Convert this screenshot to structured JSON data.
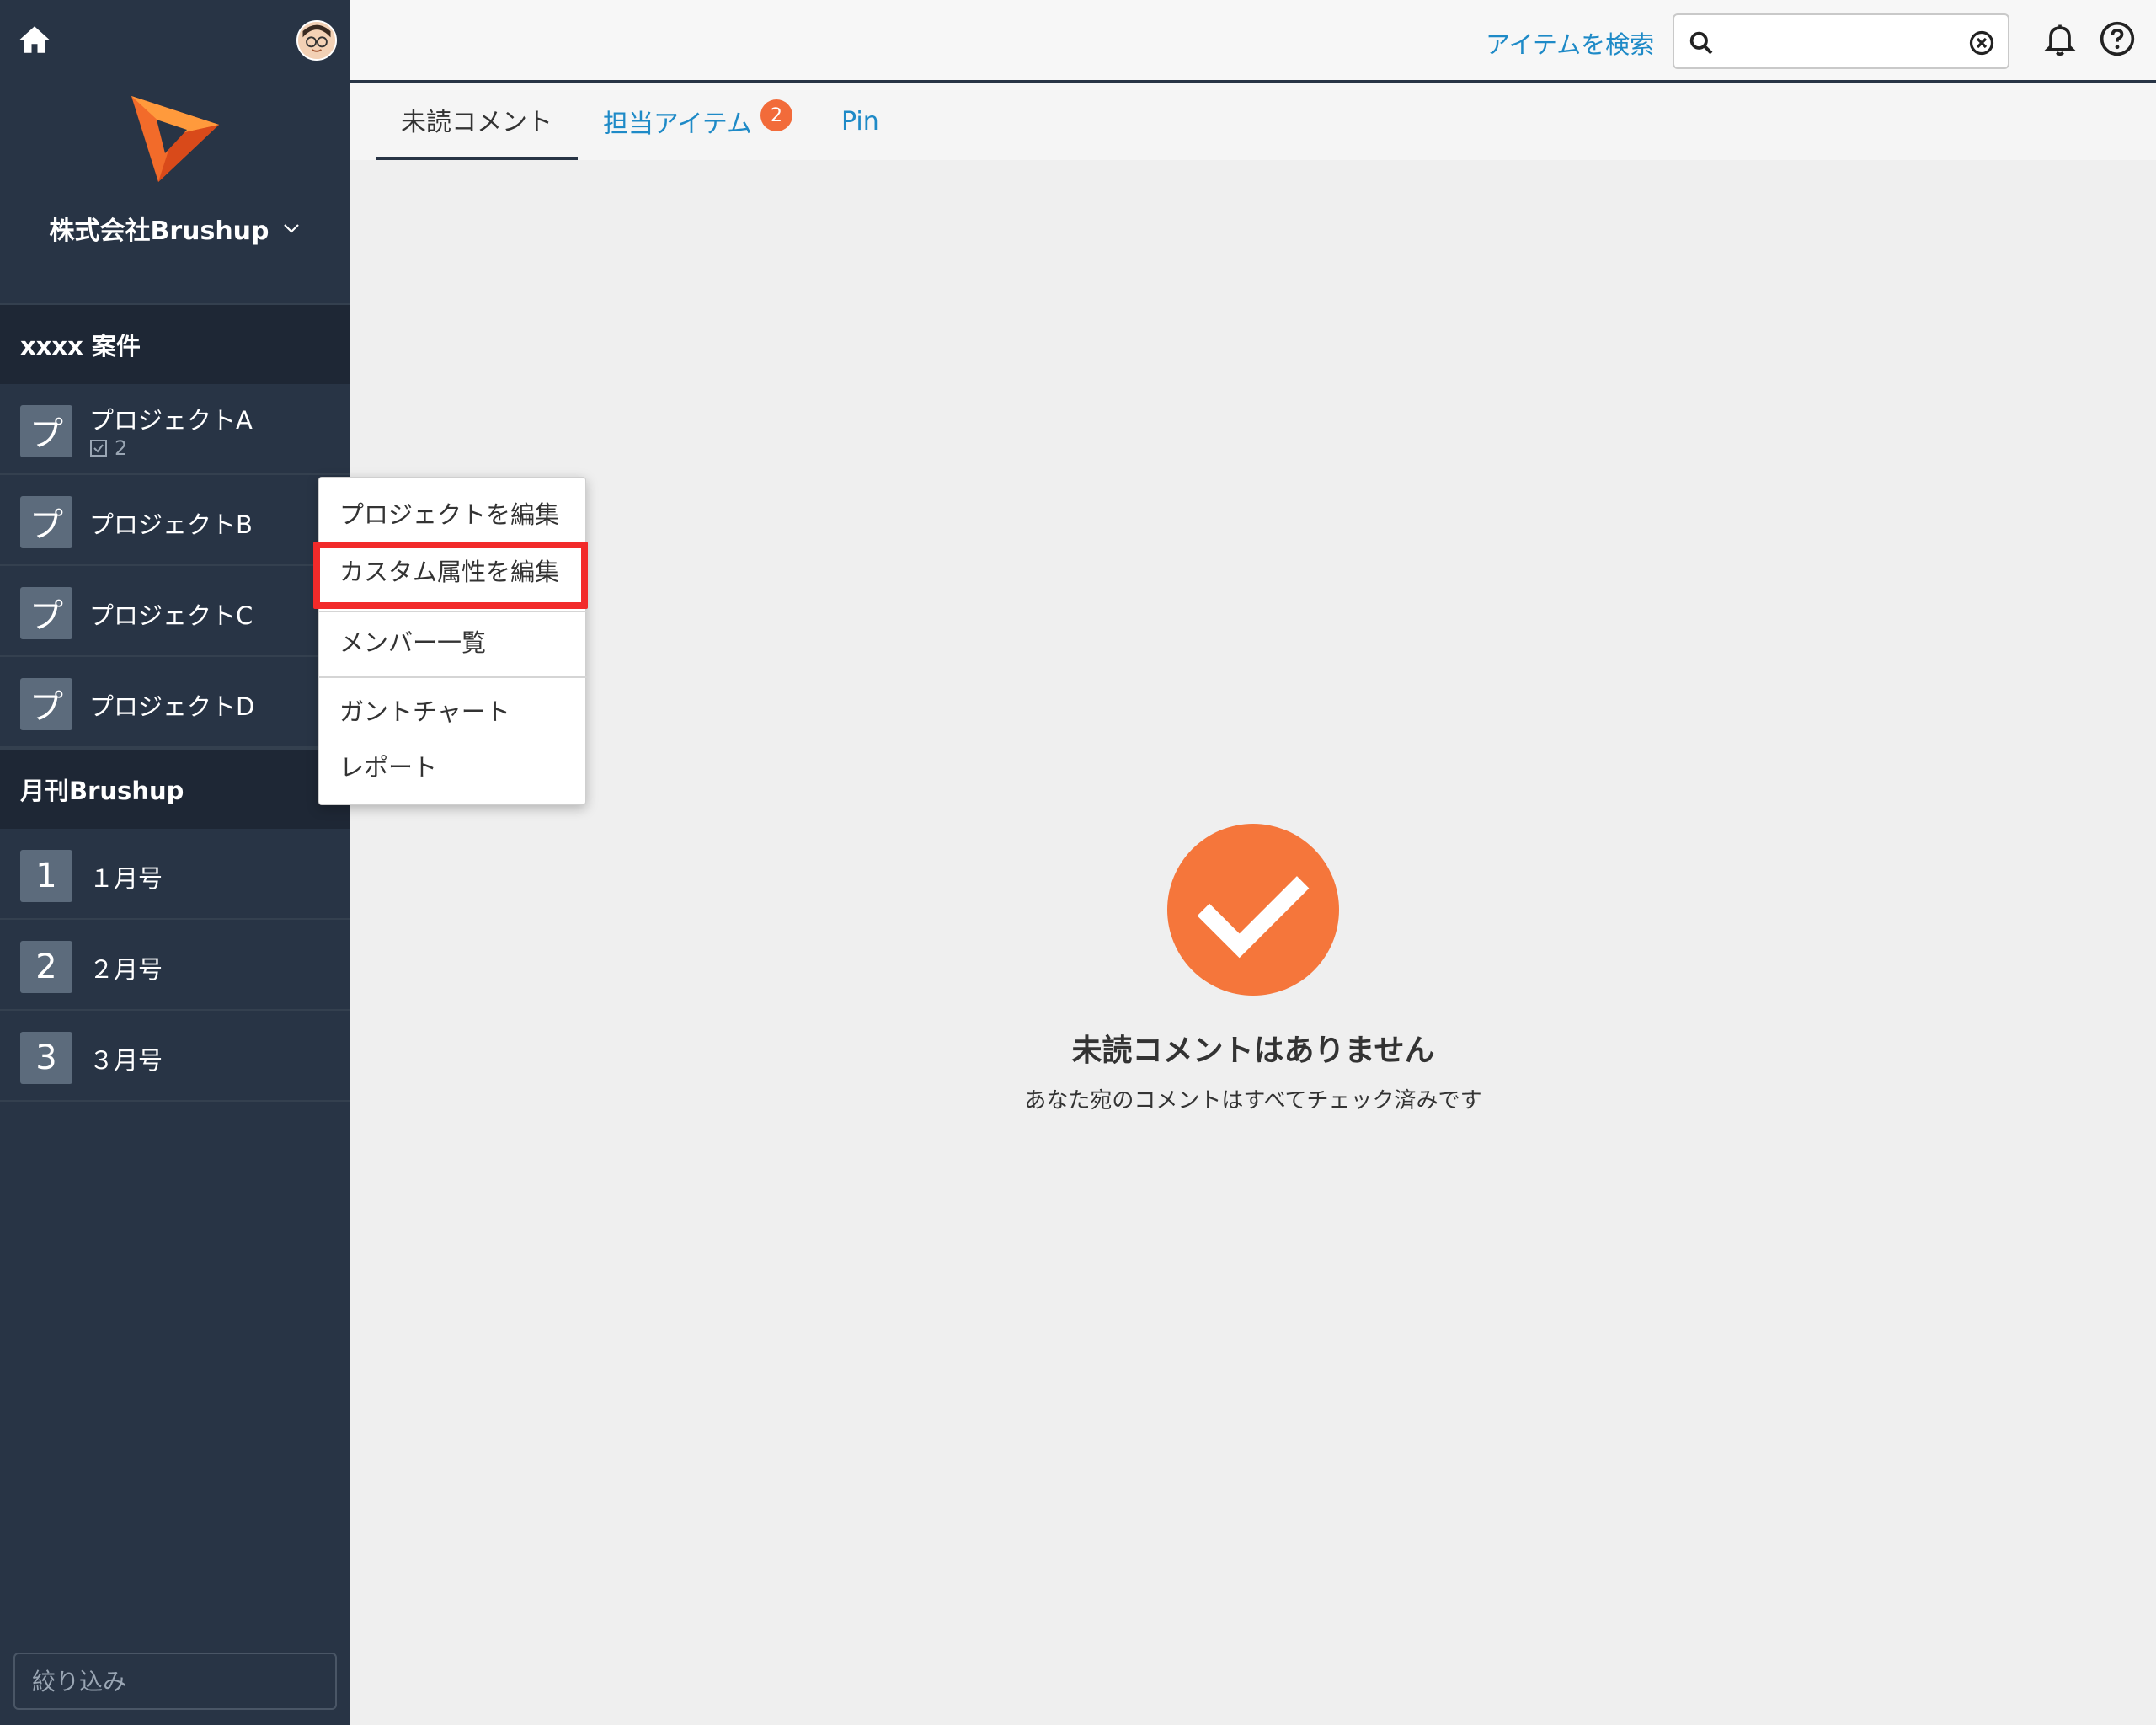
{
  "org": {
    "name": "株式会社Brushup"
  },
  "groups": [
    {
      "title": "xxxx 案件",
      "items": [
        {
          "icon": "プ",
          "label": "プロジェクトA",
          "task_count": "2"
        },
        {
          "icon": "プ",
          "label": "プロジェクトB"
        },
        {
          "icon": "プ",
          "label": "プロジェクトC"
        },
        {
          "icon": "プ",
          "label": "プロジェクトD"
        }
      ]
    },
    {
      "title": "月刊Brushup",
      "items": [
        {
          "icon": "1",
          "label": "１月号"
        },
        {
          "icon": "2",
          "label": "２月号"
        },
        {
          "icon": "3",
          "label": "３月号"
        }
      ]
    }
  ],
  "sidebar": {
    "filter_placeholder": "絞り込み"
  },
  "topbar": {
    "search_label": "アイテムを検索",
    "search_value": ""
  },
  "tabs": [
    {
      "label": "未読コメント",
      "active": true
    },
    {
      "label": "担当アイテム",
      "badge": "2"
    },
    {
      "label": "Pin"
    }
  ],
  "empty_state": {
    "title": "未読コメントはありません",
    "subtitle": "あなた宛のコメントはすべてチェック済みです"
  },
  "context_menu": {
    "items": [
      "プロジェクトを編集",
      "カスタム属性を編集",
      "メンバー一覧",
      "ガントチャート",
      "レポート"
    ],
    "highlighted": "カスタム属性を編集"
  },
  "colors": {
    "sidebar_bg": "#283445",
    "accent": "#f5763b",
    "link": "#1e8ac7",
    "highlight": "#f22a2a"
  }
}
